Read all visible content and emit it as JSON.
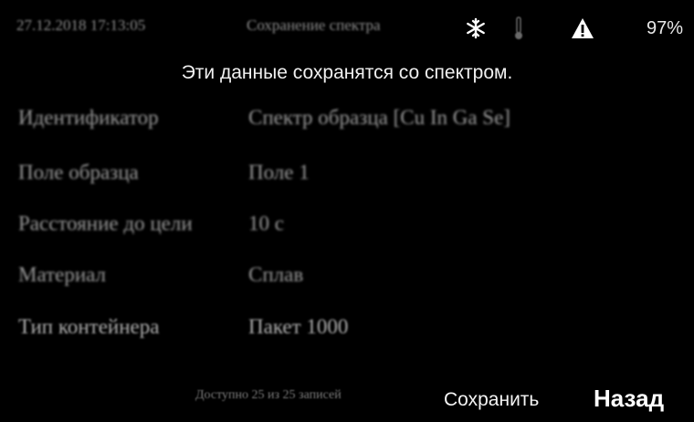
{
  "status_bar": {
    "datetime": "27.12.2018 17:13:05",
    "mode": "Сохранение спектра",
    "snow_icon": "snowflake-icon",
    "thermometer_icon": "thermometer-icon",
    "warning_icon": "warning-icon",
    "battery": "97%"
  },
  "notice": "Эти данные сохранятся со спектром.",
  "fields": [
    {
      "label": "Идентификатор",
      "value": "Спектр образца [Cu In Ga Se]"
    },
    {
      "label": "Поле образца",
      "value": "Поле 1"
    },
    {
      "label": "Расстояние до цели",
      "value": "10 с"
    },
    {
      "label": "Материал",
      "value": "Сплав"
    },
    {
      "label": "Тип контейнера",
      "value": "Пакет 1000"
    }
  ],
  "footer": {
    "memory": "Доступно 25 из 25 записей",
    "save_label": "Сохранить",
    "back_label": "Назад"
  },
  "colors": {
    "background": "#000000",
    "text": "#ffffff",
    "dim_text": "#9a9a9a"
  }
}
